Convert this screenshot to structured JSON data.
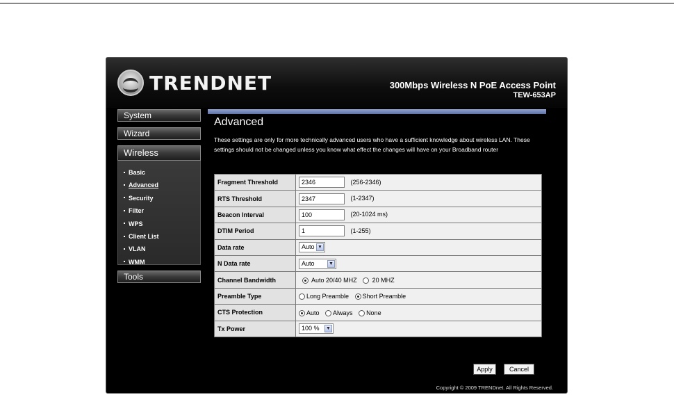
{
  "header": {
    "brand": "TRENDNET",
    "product_name": "300Mbps Wireless N PoE Access Point",
    "model": "TEW-653AP"
  },
  "nav": {
    "system": "System",
    "wizard": "Wizard",
    "wireless": "Wireless",
    "tools": "Tools",
    "wireless_items": [
      "Basic",
      "Advanced",
      "Security",
      "Filter",
      "WPS",
      "Client List",
      "VLAN",
      "WMM"
    ],
    "current_item": "Advanced"
  },
  "content": {
    "title": "Advanced",
    "description": "These settings are only for more technically advanced users who have a sufficient knowledge about wireless LAN. These settings should not be changed unless you know what effect the changes will have on your Broadband router"
  },
  "settings": {
    "fragment": {
      "label": "Fragment Threshold",
      "value": "2346",
      "range": "(256-2346)"
    },
    "rts": {
      "label": "RTS Threshold",
      "value": "2347",
      "range": "(1-2347)"
    },
    "beacon": {
      "label": "Beacon Interval",
      "value": "100",
      "range": "(20-1024 ms)"
    },
    "dtim": {
      "label": "DTIM Period",
      "value": "1",
      "range": "(1-255)"
    },
    "data_rate": {
      "label": "Data rate",
      "value": "Auto"
    },
    "n_data_rate": {
      "label": "N  Data rate",
      "value": "Auto"
    },
    "bandwidth": {
      "label": "Channel Bandwidth",
      "options": [
        "Auto 20/40 MHZ",
        "20 MHZ"
      ],
      "selected": 0
    },
    "preamble": {
      "label": "Preamble Type",
      "options": [
        "Long Preamble",
        "Short Preamble"
      ],
      "selected": 1
    },
    "cts": {
      "label": "CTS Protection",
      "options": [
        "Auto",
        "Always",
        "None"
      ],
      "selected": 0
    },
    "tx_power": {
      "label": "Tx Power",
      "value": "100 %"
    }
  },
  "buttons": {
    "apply": "Apply",
    "cancel": "Cancel"
  },
  "footer": {
    "copyright": "Copyright © 2009 TRENDnet. All Rights Reserved."
  },
  "icons": {
    "logo": "trendnet-logo-icon",
    "dropdown": "chevron-down-icon"
  }
}
